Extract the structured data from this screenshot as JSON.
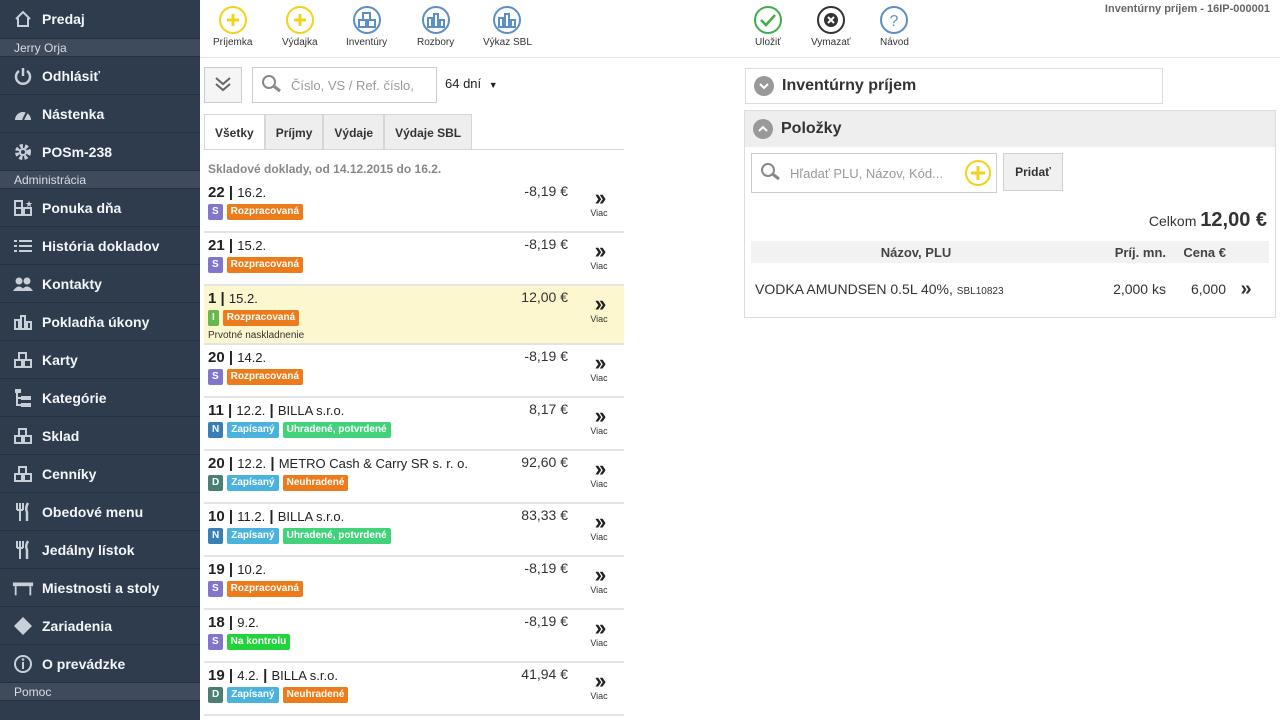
{
  "sidebar": {
    "top_item": {
      "label": "Predaj",
      "icon": "home-icon"
    },
    "user_name": "Jerry Orja",
    "items_a": [
      {
        "label": "Odhlásiť",
        "icon": "power-icon"
      },
      {
        "label": "Nástenka",
        "icon": "dashboard-icon"
      },
      {
        "label": "POSm-238",
        "icon": "gear-icon"
      }
    ],
    "section_admin": "Administrácia",
    "items_b": [
      {
        "label": "Ponuka dňa",
        "icon": "blocks-star-icon"
      },
      {
        "label": "História dokladov",
        "icon": "list-icon"
      },
      {
        "label": "Kontakty",
        "icon": "users-icon"
      },
      {
        "label": "Pokladňa úkony",
        "icon": "bar-chart-icon"
      },
      {
        "label": "Karty",
        "icon": "blocks-icon"
      },
      {
        "label": "Kategórie",
        "icon": "tree-icon"
      },
      {
        "label": "Sklad",
        "icon": "blocks-icon"
      },
      {
        "label": "Cenníky",
        "icon": "blocks-icon"
      },
      {
        "label": "Obedové menu",
        "icon": "cutlery-icon"
      },
      {
        "label": "Jedálny lístok",
        "icon": "cutlery-icon"
      },
      {
        "label": "Miestnosti a stoly",
        "icon": "table-icon"
      },
      {
        "label": "Zariadenia",
        "icon": "diamond-icon"
      },
      {
        "label": "O prevádzke",
        "icon": "info-icon"
      }
    ],
    "section_help": "Pomoc"
  },
  "toolbar": {
    "left": [
      {
        "label": "Príjemka",
        "icon": "plus-icon",
        "color": "#f2d21c"
      },
      {
        "label": "Výdajka",
        "icon": "plus-icon",
        "color": "#f2d21c"
      },
      {
        "label": "Inventúry",
        "icon": "blocks-icon",
        "color": "#5b8fc7"
      },
      {
        "label": "Rozbory",
        "icon": "bar-chart-icon",
        "color": "#5b8fc7"
      },
      {
        "label": "Výkaz SBL",
        "icon": "bar-chart-icon",
        "color": "#5b8fc7"
      }
    ],
    "right": [
      {
        "label": "Uložiť",
        "icon": "check-icon",
        "color": "#3fae49"
      },
      {
        "label": "Vymazať",
        "icon": "x-icon",
        "color": "#333333"
      },
      {
        "label": "Návod",
        "icon": "question-icon",
        "color": "#5b8fc7"
      }
    ],
    "doc_title": "Inventúrny príjem - 16IP-000001"
  },
  "filter": {
    "search_placeholder": "Číslo, VS / Ref. číslo,",
    "days": "64 dní"
  },
  "tabs": [
    "Všetky",
    "Príjmy",
    "Výdaje",
    "Výdaje SBL"
  ],
  "list_caption": "Skladové doklady, od 14.12.2015 do 16.2.",
  "more_label": "Viac",
  "documents": [
    {
      "num": "22",
      "date": "16.2.",
      "partner": "",
      "amount": "-8,19 €",
      "badges": [
        {
          "text": "S",
          "color": "#8176c9"
        },
        {
          "text": "Rozpracovaná",
          "color": "#ec7b1c"
        }
      ],
      "note": ""
    },
    {
      "num": "21",
      "date": "15.2.",
      "partner": "",
      "amount": "-8,19 €",
      "badges": [
        {
          "text": "S",
          "color": "#8176c9"
        },
        {
          "text": "Rozpracovaná",
          "color": "#ec7b1c"
        }
      ],
      "note": ""
    },
    {
      "num": "1",
      "date": "15.2.",
      "partner": "",
      "amount": "12,00 €",
      "badges": [
        {
          "text": "I",
          "color": "#66b94a"
        },
        {
          "text": "Rozpracovaná",
          "color": "#ec7b1c"
        }
      ],
      "note": "Prvotné naskladnenie",
      "selected": true
    },
    {
      "num": "20",
      "date": "14.2.",
      "partner": "",
      "amount": "-8,19 €",
      "badges": [
        {
          "text": "S",
          "color": "#8176c9"
        },
        {
          "text": "Rozpracovaná",
          "color": "#ec7b1c"
        }
      ],
      "note": ""
    },
    {
      "num": "11",
      "date": "12.2.",
      "partner": "BILLA s.r.o.",
      "amount": "8,17 €",
      "badges": [
        {
          "text": "N",
          "color": "#3a7fb4"
        },
        {
          "text": "Zapísaný",
          "color": "#4ab3dd"
        },
        {
          "text": "Uhradené, potvrdené",
          "color": "#41d27a"
        }
      ],
      "note": ""
    },
    {
      "num": "20",
      "date": "12.2.",
      "partner": "METRO Cash & Carry SR s. r. o.",
      "amount": "92,60 €",
      "badges": [
        {
          "text": "D",
          "color": "#4c7f73"
        },
        {
          "text": "Zapísaný",
          "color": "#4ab3dd"
        },
        {
          "text": "Neuhradené",
          "color": "#ec7b1c"
        }
      ],
      "note": ""
    },
    {
      "num": "10",
      "date": "11.2.",
      "partner": "BILLA s.r.o.",
      "amount": "83,33 €",
      "badges": [
        {
          "text": "N",
          "color": "#3a7fb4"
        },
        {
          "text": "Zapísaný",
          "color": "#4ab3dd"
        },
        {
          "text": "Uhradené, potvrdené",
          "color": "#41d27a"
        }
      ],
      "note": ""
    },
    {
      "num": "19",
      "date": "10.2.",
      "partner": "",
      "amount": "-8,19 €",
      "badges": [
        {
          "text": "S",
          "color": "#8176c9"
        },
        {
          "text": "Rozpracovaná",
          "color": "#ec7b1c"
        }
      ],
      "note": ""
    },
    {
      "num": "18",
      "date": "9.2.",
      "partner": "",
      "amount": "-8,19 €",
      "badges": [
        {
          "text": "S",
          "color": "#8176c9"
        },
        {
          "text": "Na kontrolu",
          "color": "#21d43a"
        }
      ],
      "note": ""
    },
    {
      "num": "19",
      "date": "4.2.",
      "partner": "BILLA s.r.o.",
      "amount": "41,94 €",
      "badges": [
        {
          "text": "D",
          "color": "#4c7f73"
        },
        {
          "text": "Zapísaný",
          "color": "#4ab3dd"
        },
        {
          "text": "Neuhradené",
          "color": "#ec7b1c"
        }
      ],
      "note": ""
    }
  ],
  "detail": {
    "section1_title": "Inventúrny príjem",
    "section2_title": "Položky",
    "item_search_placeholder": "Hľadať PLU, Názov, Kód...",
    "add_label": "Pridať",
    "total_label": "Celkom",
    "total_value": "12,00 €",
    "columns": [
      "Názov, PLU",
      "Príj. mn.",
      "Cena €"
    ],
    "items": [
      {
        "name": "VODKA AMUNDSEN 0.5L 40%,",
        "plu": "SBL10823",
        "qty": "2,000 ks",
        "price": "6,000"
      }
    ]
  }
}
